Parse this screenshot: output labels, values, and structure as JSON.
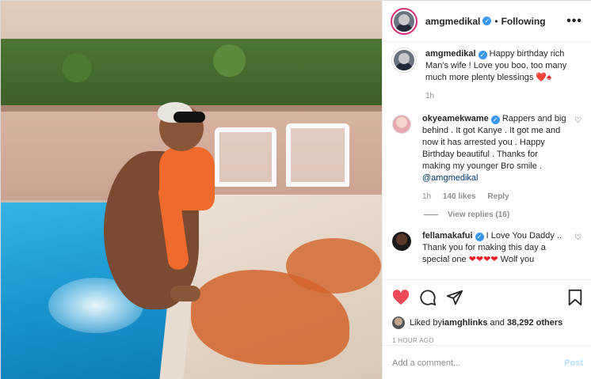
{
  "header": {
    "username": "amgmedikal",
    "separator": "•",
    "follow_status": "Following",
    "more_label": "•••"
  },
  "caption": {
    "username": "amgmedikal",
    "text": "Happy birthday rich Man's wife ! Love you boo, too many much more plenty blessings",
    "emoji": "❤️♠",
    "time": "1h"
  },
  "comments": [
    {
      "username": "okyeamekwame",
      "text": "Rappers and big behind . It got Kanye . It got me and now it has arrested you . Happy Birthday beautiful . Thanks for making my younger Bro smile . ",
      "mention": "@amgmedikal",
      "time": "1h",
      "likes": "140 likes",
      "reply_label": "Reply",
      "view_replies": "View replies (16)"
    },
    {
      "username": "fellamakafui",
      "text": "I Love You Daddy .. Thank you for making this day a special one ",
      "hearts": "❤❤❤❤",
      "text_after": " Wolf you"
    }
  ],
  "likes": {
    "prefix": "Liked by ",
    "user": "iamghlinks",
    "middle": " and ",
    "count": "38,292 others"
  },
  "timestamp": "1 HOUR AGO",
  "add_comment": {
    "placeholder": "Add a comment...",
    "post_label": "Post"
  },
  "colors": {
    "verified": "#3897f0",
    "like_red": "#ed4956",
    "post_disabled": "#b2dffc",
    "muted": "#8e8e8e"
  },
  "icons": [
    "heart-icon",
    "comment-icon",
    "share-icon",
    "bookmark-icon",
    "verified-icon",
    "more-icon"
  ]
}
